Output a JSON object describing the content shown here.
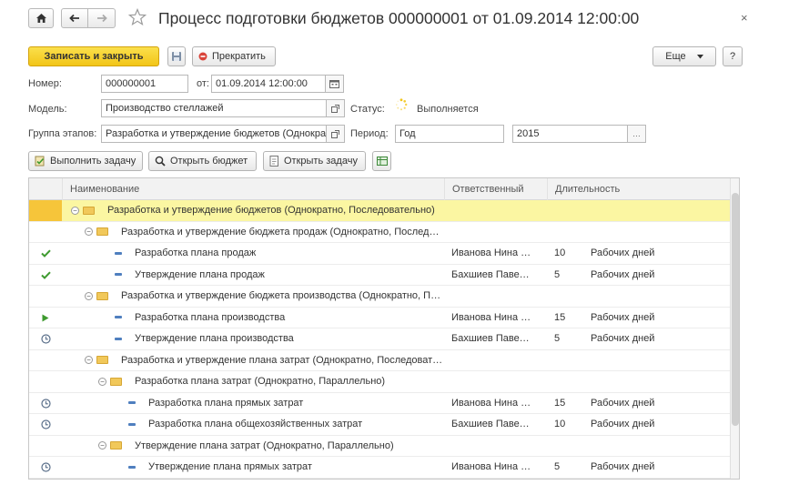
{
  "window": {
    "title": "Процесс подготовки бюджетов 000000001 от 01.09.2014 12:00:00",
    "close_glyph": "×"
  },
  "toolbar": {
    "save_close": "Записать и закрыть",
    "stop": "Прекратить",
    "more": "Еще",
    "help": "?"
  },
  "form": {
    "number_label": "Номер:",
    "number_value": "000000001",
    "date_label": "от:",
    "date_value": "01.09.2014 12:00:00",
    "model_label": "Модель:",
    "model_value": "Производство стеллажей",
    "status_label": "Статус:",
    "status_value": "Выполняется",
    "stage_group_label": "Группа этапов:",
    "stage_group_value": "Разработка и утверждение бюджетов (Однократно, П",
    "period_label": "Период:",
    "period_value": "Год",
    "year_value": "2015"
  },
  "actions": {
    "run_task": "Выполнить задачу",
    "open_budget": "Открыть бюджет",
    "open_task": "Открыть задачу"
  },
  "grid": {
    "columns": [
      "Наименование",
      "Ответственный",
      "Длительность"
    ],
    "rows": [
      {
        "status": "none",
        "level": 0,
        "type": "group",
        "name": "Разработка и утверждение бюджетов (Однократно, Последовательно)",
        "owner": "",
        "duration": "",
        "unit": "",
        "selected": true
      },
      {
        "status": "none",
        "level": 1,
        "type": "group",
        "name": "Разработка и утверждение бюджета продаж (Однократно, Послед…",
        "owner": "",
        "duration": "",
        "unit": ""
      },
      {
        "status": "done",
        "level": 2,
        "type": "task",
        "name": "Разработка плана продаж",
        "owner": "Иванова Нина …",
        "duration": "10",
        "unit": "Рабочих дней"
      },
      {
        "status": "done",
        "level": 2,
        "type": "task",
        "name": "Утверждение плана продаж",
        "owner": "Бахшиев Паве…",
        "duration": "5",
        "unit": "Рабочих дней"
      },
      {
        "status": "none",
        "level": 1,
        "type": "group",
        "name": "Разработка и утверждение бюджета производства (Однократно, П…",
        "owner": "",
        "duration": "",
        "unit": ""
      },
      {
        "status": "running",
        "level": 2,
        "type": "task",
        "name": "Разработка плана производства",
        "owner": "Иванова Нина …",
        "duration": "15",
        "unit": "Рабочих дней"
      },
      {
        "status": "waiting",
        "level": 2,
        "type": "task",
        "name": "Утверждение плана производства",
        "owner": "Бахшиев Паве…",
        "duration": "5",
        "unit": "Рабочих дней"
      },
      {
        "status": "none",
        "level": 1,
        "type": "group",
        "name": "Разработка и утверждение плана затрат (Однократно, Последоват…",
        "owner": "",
        "duration": "",
        "unit": ""
      },
      {
        "status": "none",
        "level": 2,
        "type": "group",
        "name": "Разработка плана затрат (Однократно, Параллельно)",
        "owner": "",
        "duration": "",
        "unit": ""
      },
      {
        "status": "waiting",
        "level": 3,
        "type": "task",
        "name": "Разработка плана прямых затрат",
        "owner": "Иванова Нина …",
        "duration": "15",
        "unit": "Рабочих дней"
      },
      {
        "status": "waiting",
        "level": 3,
        "type": "task",
        "name": "Разработка плана общехозяйственных затрат",
        "owner": "Бахшиев Паве…",
        "duration": "10",
        "unit": "Рабочих дней"
      },
      {
        "status": "none",
        "level": 2,
        "type": "group",
        "name": "Утверждение плана затрат (Однократно, Параллельно)",
        "owner": "",
        "duration": "",
        "unit": ""
      },
      {
        "status": "waiting",
        "level": 3,
        "type": "task",
        "name": "Утверждение плана прямых затрат",
        "owner": "Иванова Нина …",
        "duration": "5",
        "unit": "Рабочих дней"
      }
    ]
  },
  "colors": {
    "accent": "#f2c518",
    "selected_row": "#fbf6a2",
    "done": "#3e9a2f",
    "running": "#3e9a2f",
    "waiting": "#5a6f8a"
  },
  "icons": {
    "home": "home-icon",
    "back": "arrow-left-icon",
    "forward": "arrow-right-icon",
    "favorite": "star-icon",
    "save": "floppy-icon",
    "stop": "stop-icon",
    "calendar": "calendar-icon",
    "open": "open-link-icon",
    "status": "spinner-icon",
    "run": "run-task-icon",
    "budget": "magnifier-icon",
    "task": "document-icon",
    "excel": "table-icon"
  }
}
